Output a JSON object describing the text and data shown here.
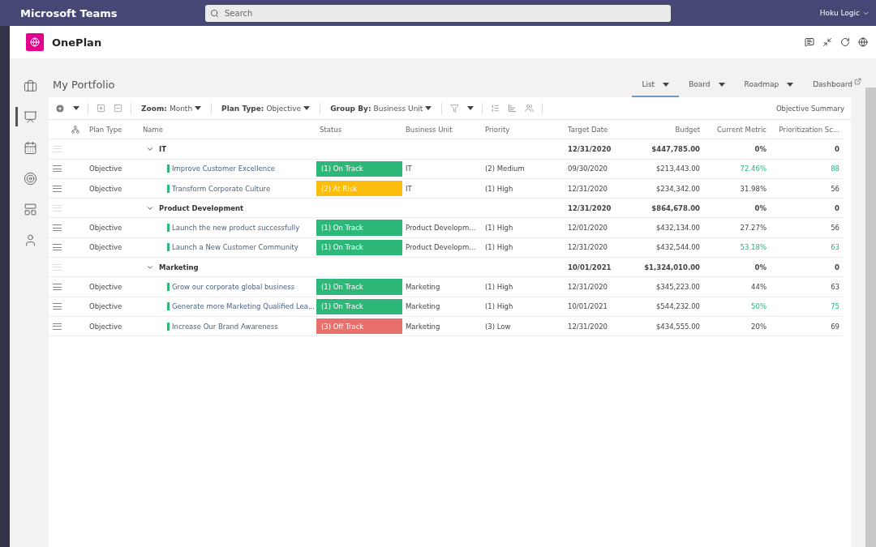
{
  "app": {
    "name": "Microsoft Teams",
    "search": {
      "placeholder": "Search"
    },
    "account": "Hoku Logic"
  },
  "plugin": {
    "name": "OnePlan"
  },
  "sidebar": {
    "items": [
      {
        "selected": false
      },
      {
        "selected": true
      },
      {
        "selected": false
      },
      {
        "selected": false
      },
      {
        "selected": false
      },
      {
        "selected": false
      }
    ]
  },
  "page": {
    "title": "My Portfolio",
    "views": [
      {
        "label": "List",
        "selected": true,
        "dropdown": true
      },
      {
        "label": "Board",
        "selected": false,
        "dropdown": true
      },
      {
        "label": "Roadmap",
        "selected": false,
        "dropdown": true
      },
      {
        "label": "Dashboard",
        "selected": false,
        "dropdown": false
      }
    ]
  },
  "toolbar": {
    "filters": [
      {
        "label": "Zoom:",
        "value": "Month"
      },
      {
        "label": "Plan Type:",
        "value": "Objective"
      },
      {
        "label": "Group By:",
        "value": "Business Unit"
      }
    ],
    "summary": "Objective Summary"
  },
  "table": {
    "columns": [
      "Plan Type",
      "Name",
      "Status",
      "Business Unit",
      "Priority",
      "Target Date",
      "Budget",
      "Current Metric",
      "Prioritization Sc..."
    ],
    "groups": [
      {
        "name": "IT",
        "expanded": true,
        "target": "12/31/2020",
        "budget": "$447,785.00",
        "metric": "0%",
        "score": "0",
        "rows": [
          {
            "plan_type": "Objective",
            "name": "Improve Customer Excellence",
            "status": "(1) On Track",
            "color": "#2db87a",
            "unit": "IT",
            "priority": "(2) Medium",
            "target": "09/30/2020",
            "budget": "$213,443.00",
            "metric": "72.46%",
            "score": "88",
            "on_target": true
          },
          {
            "plan_type": "Objective",
            "name": "Transform Corporate Culture",
            "status": "(2) At Risk",
            "color": "#fcbd0e",
            "unit": "IT",
            "priority": "(1) High",
            "target": "12/31/2020",
            "budget": "$234,342.00",
            "metric": "31.98%",
            "score": "56",
            "on_target": false
          }
        ]
      },
      {
        "name": "Product Development",
        "expanded": true,
        "target": "12/31/2020",
        "budget": "$864,678.00",
        "metric": "0%",
        "score": "0",
        "rows": [
          {
            "plan_type": "Objective",
            "name": "Launch the new product successfully",
            "status": "(1) On Track",
            "color": "#2db87a",
            "unit": "Product Developm...",
            "priority": "(1) High",
            "target": "12/01/2020",
            "budget": "$432,134.00",
            "metric": "27.27%",
            "score": "56",
            "on_target": false
          },
          {
            "plan_type": "Objective",
            "name": "Launch a New Customer Community",
            "status": "(1) On Track",
            "color": "#2db87a",
            "unit": "Product Developm...",
            "priority": "(1) High",
            "target": "12/31/2020",
            "budget": "$432,544.00",
            "metric": "53.18%",
            "score": "63",
            "on_target": true
          }
        ]
      },
      {
        "name": "Marketing",
        "expanded": true,
        "target": "10/01/2021",
        "budget": "$1,324,010.00",
        "metric": "0%",
        "score": "0",
        "rows": [
          {
            "plan_type": "Objective",
            "name": "Grow our corporate global business",
            "status": "(1) On Track",
            "color": "#2db87a",
            "unit": "Marketing",
            "priority": "(1) High",
            "target": "12/31/2020",
            "budget": "$345,223.00",
            "metric": "44%",
            "score": "63",
            "on_target": false
          },
          {
            "plan_type": "Objective",
            "name": "Generate more Marketing Qualified Lea...",
            "status": "(1) On Track",
            "color": "#2db87a",
            "unit": "Marketing",
            "priority": "(1) High",
            "target": "10/01/2021",
            "budget": "$544,232.00",
            "metric": "50%",
            "score": "75",
            "on_target": true
          },
          {
            "plan_type": "Objective",
            "name": "Increase Our Brand Awareness",
            "status": "(3) Off Track",
            "color": "#e8716d",
            "unit": "Marketing",
            "priority": "(3) Low",
            "target": "12/31/2020",
            "budget": "$434,555.00",
            "metric": "20%",
            "score": "69",
            "on_target": false
          }
        ]
      }
    ]
  }
}
